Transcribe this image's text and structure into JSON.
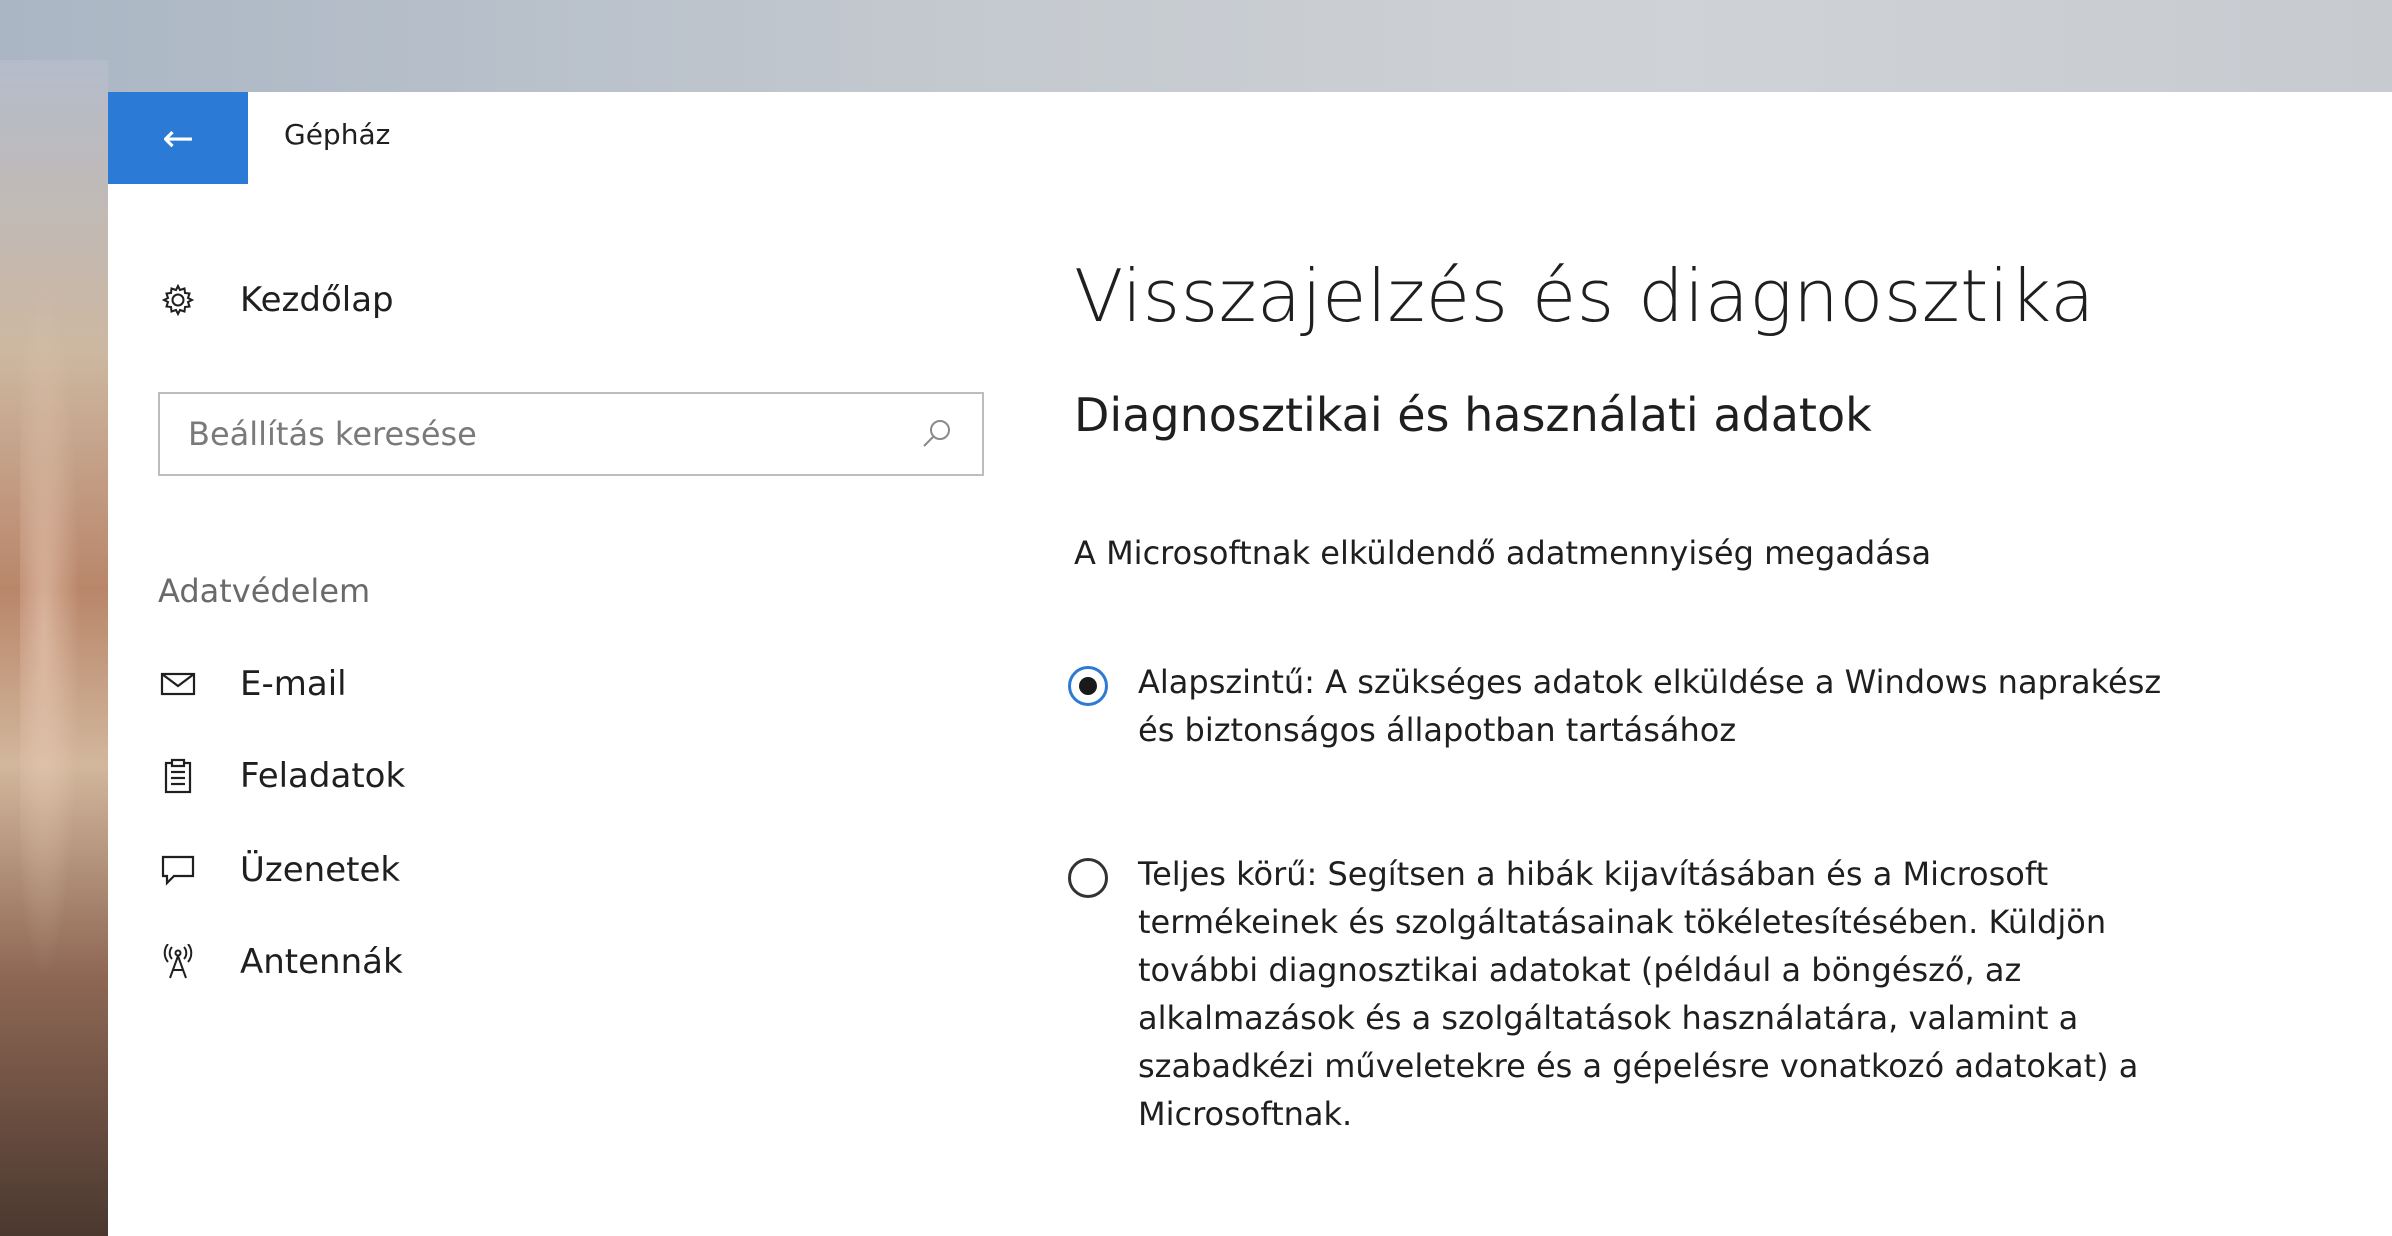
{
  "window": {
    "back_icon": "left-arrow-icon",
    "title": "Gépház",
    "accent_color": "#2b7bd6"
  },
  "sidebar": {
    "home": {
      "icon": "gear-icon",
      "label": "Kezdőlap"
    },
    "search": {
      "placeholder": "Beállítás keresése",
      "value": "",
      "icon": "search-icon"
    },
    "section_label": "Adatvédelem",
    "items": [
      {
        "icon": "mail-icon",
        "label": "E-mail"
      },
      {
        "icon": "clipboard-icon",
        "label": "Feladatok"
      },
      {
        "icon": "chat-icon",
        "label": "Üzenetek"
      },
      {
        "icon": "antenna-icon",
        "label": "Antennák"
      }
    ]
  },
  "main": {
    "title": "Visszajelzés és diagnosztika",
    "subtitle": "Diagnosztikai és használati adatok",
    "description": "A Microsoftnak elküldendő adatmennyiség megadása",
    "options": [
      {
        "label": "Alapszintű: A szükséges adatok elküldése a Windows naprakész\nés biztonságos állapotban tartásához",
        "selected": true
      },
      {
        "label": "Teljes körű: Segítsen a hibák kijavításában és a Microsoft\ntermékeinek és szolgáltatásainak tökéletesítésében. Küldjön\ntovábbi diagnosztikai adatokat (például a böngésző, az\nalkalmazások és a szolgáltatások használatára, valamint a\nszabadkézi műveletekre és a gépelésre vonatkozó adatokat) a\nMicrosoftnak.",
        "selected": false
      }
    ]
  }
}
